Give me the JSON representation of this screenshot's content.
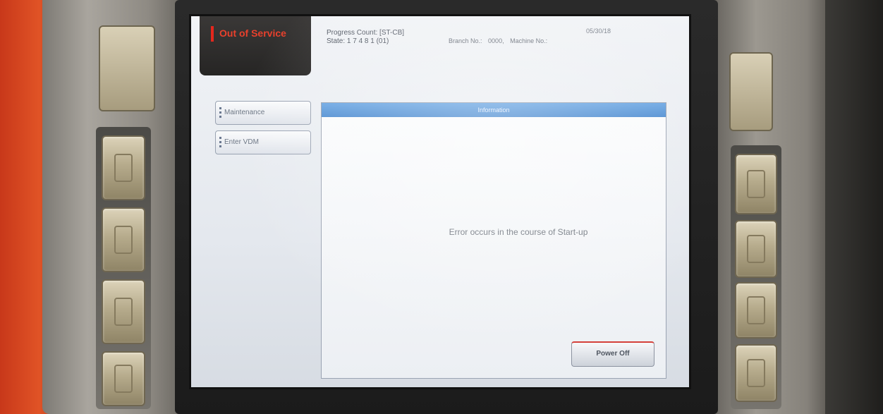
{
  "status": {
    "label": "Out of Service",
    "color": "#e4271d"
  },
  "header": {
    "progress_count": "Progress Count: [ST-CB]",
    "state": "State: 1 7 4 8 1 (01)",
    "branch": "Branch No.:",
    "branch_value": "0000,",
    "machine": "Machine No.:",
    "datetime": "05/30/18"
  },
  "sidebar": {
    "items": [
      {
        "label": "Maintenance"
      },
      {
        "label": "Enter VDM"
      }
    ]
  },
  "panel": {
    "title": "Information",
    "message": "Error occurs in the course of Start-up",
    "power_off_label": "Power Off"
  },
  "colors": {
    "accent_blue": "#4d8cd1",
    "housing_red": "#e05326"
  }
}
